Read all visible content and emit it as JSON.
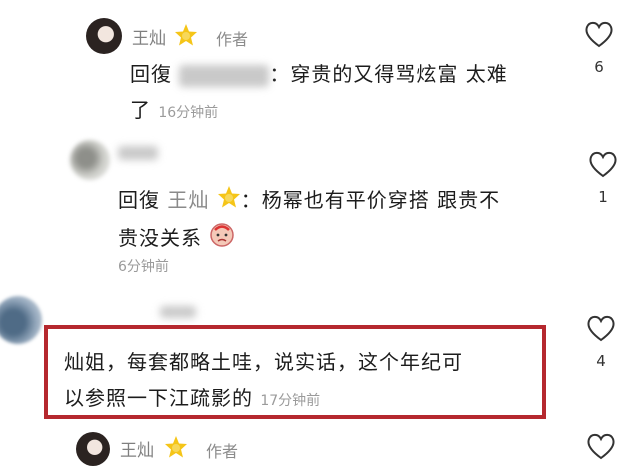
{
  "comments": [
    {
      "author": "王灿",
      "author_tag": "作者",
      "reply_prefix": "回復",
      "mention_suffix": "：",
      "text_line1": "穿贵的又得骂炫富 太难",
      "text_line2": "了",
      "time": "16分钟前",
      "likes": "6"
    },
    {
      "reply_prefix": "回復",
      "mention": "王灿",
      "mention_suffix": "：",
      "text_line1": "杨幂也有平价穿搭 跟贵不",
      "text_line2": "贵没关系",
      "time": "6分钟前",
      "likes": "1"
    },
    {
      "text_line1": "灿姐，每套都略土哇，说实话，这个年纪可",
      "text_line2": "以参照一下江疏影的",
      "time": "17分钟前",
      "likes": "4"
    },
    {
      "author": "王灿",
      "author_tag": "作者"
    }
  ],
  "icons": {
    "like": "heart-outline-icon",
    "star": "sun-star-badge-icon",
    "emoji": "pouting-face-emoji-icon"
  },
  "colors": {
    "highlight_border": "#b5282e",
    "star": "#f5c518"
  }
}
